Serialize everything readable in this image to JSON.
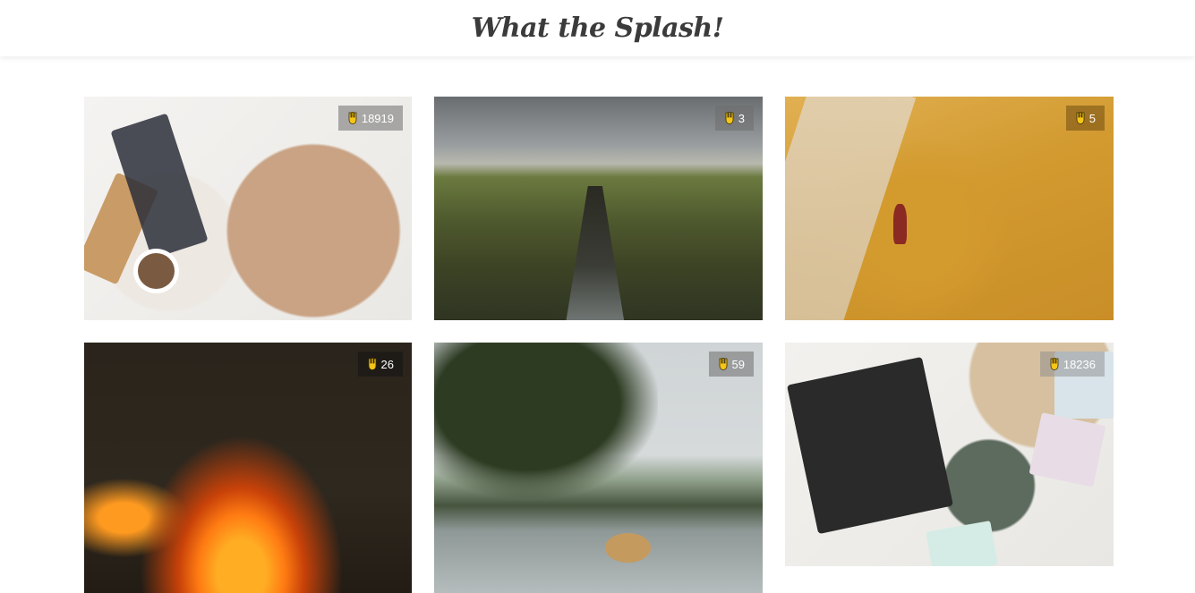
{
  "header": {
    "title": "What the Splash!"
  },
  "photos": [
    {
      "likes": "18919",
      "subject": "blueberry toast spread"
    },
    {
      "likes": "3",
      "subject": "green canyon"
    },
    {
      "likes": "5",
      "subject": "person raking sand"
    },
    {
      "likes": "26",
      "subject": "campfire flames"
    },
    {
      "likes": "59",
      "subject": "woman with straw hat by lake"
    },
    {
      "likes": "18236",
      "subject": "crispbread snack board"
    }
  ],
  "colors": {
    "accent_icon": "#f5c518",
    "badge_bg": "#6e6e6e",
    "header_text": "#3b3b3b"
  }
}
